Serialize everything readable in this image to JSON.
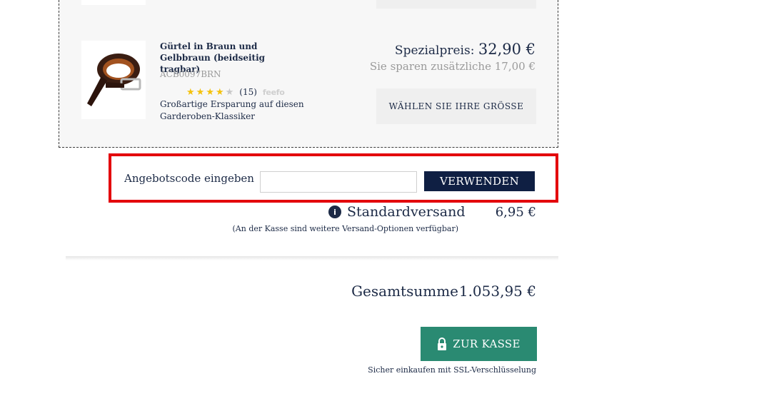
{
  "upsell_product": {
    "title": "Gürtel in Braun und Gelbbraun (beidseitig tragbar)",
    "sku": "ACB0097BRN",
    "rating": {
      "stars": 4,
      "max_stars": 5,
      "count_label": "(15)",
      "provider": "feefo"
    },
    "description": "Großartige Ersparung auf diesen Garderoben-Klassiker",
    "special_price_label": "Spezialpreis:",
    "special_price": "32,90 €",
    "savings_text": "Sie sparen zusätzliche 17,00 €",
    "size_button_label": "WÄHLEN SIE IHRE GRÖSSE"
  },
  "promo": {
    "label": "Angebotscode eingeben",
    "input_value": "",
    "input_placeholder": "",
    "apply_button_label": "VERWENDEN",
    "highlight_color": "#e3000b"
  },
  "shipping": {
    "info_icon_glyph": "i",
    "label": "Standardversand",
    "price": "6,95 €",
    "note": "(An der Kasse sind weitere Versand-Optionen verfügbar)"
  },
  "totals": {
    "label": "Gesamtsumme",
    "value": "1.053,95 €"
  },
  "checkout": {
    "button_label": "ZUR KASSE",
    "icon": "lock-icon",
    "secure_note": "Sicher einkaufen mit SSL-Verschlüsselung",
    "button_color": "#2a8a72"
  },
  "colors": {
    "navy": "#0f1f43",
    "text": "#1c2a46",
    "muted": "#9a9a9a",
    "star": "#f4c20d"
  }
}
